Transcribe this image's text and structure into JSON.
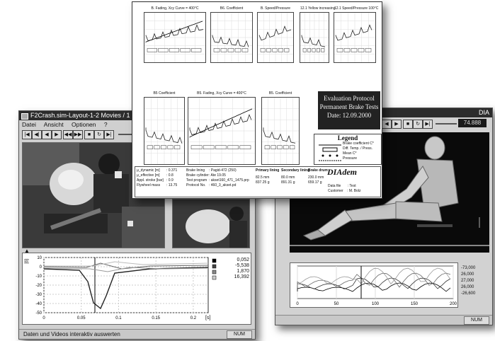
{
  "crash_window": {
    "title": "F2Crash.sim-Layout-1-2 Movies / 1 Chart - DIA",
    "menu": [
      "Datei",
      "Ansicht",
      "Optionen",
      "?"
    ],
    "chart": {
      "yticks": [
        "10",
        "0",
        "-10",
        "-20",
        "-30",
        "-40",
        "-50"
      ],
      "xticks": [
        "0",
        "0.05",
        "0.1",
        "0.15",
        "0.2"
      ],
      "xunit": "[s]",
      "ylabel": "[g]",
      "legend_values": [
        "0,052",
        "-5,538",
        "1,870",
        "16,392"
      ]
    },
    "status_text": "Daten und Videos interaktiv auswerten",
    "status_box": "NUM"
  },
  "protocol_doc": {
    "plot_titles": [
      "B. Fading, Xcy Curve = 400°C",
      "B6. Coefficient",
      "B. Speed/Pressure",
      "12.1 Yellow increasing",
      "12.1 Speed/Pressure 100°C",
      "B5 Coefficient",
      "B5. Fading, Xcy Curve = 400°C",
      "B5. Coefficient"
    ],
    "protocol_title": [
      "Evaluation Protocol",
      "Permanent Brake Tests",
      "Date: 12.09.2000"
    ],
    "legend_title": "Legend",
    "legend_items": [
      "Brake coefficient C*",
      "Diff. Temp. / Press.",
      "Mean C*",
      "Pressure"
    ],
    "table": {
      "col1": [
        "μ_dynamic [m]",
        "μ_effective [m]",
        "Appl. stroke [bar]",
        "Flywheel mass"
      ],
      "col1_values": [
        ": 0.371",
        ": 0.8",
        ": 0.9",
        ": 13.75"
      ],
      "col2": [
        "Brake lining",
        "Brake cylinder",
        "Test program",
        "Protocol No."
      ],
      "col2_values": [
        ": Pagid-472 (250)",
        ": Ate 19.05",
        ": akset160_471_1475.prp",
        ": 460_3_akset.pd"
      ],
      "primary_header": "Primary lining",
      "primary_rows": [
        [
          "82.5",
          "mm"
        ],
        [
          "837.25",
          "g"
        ]
      ],
      "secondary_header": "Secondary lining",
      "secondary_rows": [
        [
          "80.0",
          "mm"
        ],
        [
          "891.31",
          "g"
        ]
      ],
      "brake_drum_header": "Brake drum",
      "brake_drum_rows": [
        [
          "230.0",
          "mm"
        ],
        [
          "659.17",
          "g"
        ]
      ],
      "logo": "DIAdem",
      "data_file_label": "Data file",
      "data_file_value": ": Test",
      "customer_label": "Customer",
      "customer_value": ": M. Bolz"
    }
  },
  "dummy_window": {
    "title": "DIA",
    "value_box": "74.888",
    "side_values": [
      "-73,000",
      "26,000",
      "27,000",
      "26,000",
      "-26,600"
    ],
    "xticks": [
      "0",
      "50",
      "100",
      "150",
      "200"
    ],
    "status_box": "NUM"
  }
}
